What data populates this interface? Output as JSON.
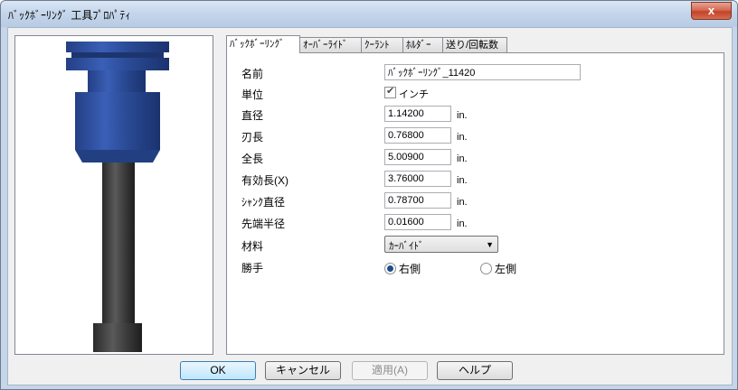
{
  "window": {
    "title": "ﾊﾞｯｸﾎﾞｰﾘﾝｸﾞ 工具ﾌﾟﾛﾊﾟﾃｨ",
    "close_label": "x"
  },
  "tabs": [
    {
      "label": "ﾊﾞｯｸﾎﾞｰﾘﾝｸﾞ",
      "active": true
    },
    {
      "label": "ｵｰﾊﾞｰﾗｲﾄﾞ",
      "active": false
    },
    {
      "label": "ｸｰﾗﾝﾄ",
      "active": false
    },
    {
      "label": "ﾎﾙﾀﾞｰ",
      "active": false
    },
    {
      "label": "送り/回転数",
      "active": false
    }
  ],
  "form": {
    "name_label": "名前",
    "name_value": "ﾊﾞｯｸﾎﾞｰﾘﾝｸﾞ_11420",
    "unit_label": "単位",
    "unit_checkbox_label": "インチ",
    "unit_checked": true,
    "unit_text": "in.",
    "rows": [
      {
        "label": "直径",
        "value": "1.14200"
      },
      {
        "label": "刃長",
        "value": "0.76800"
      },
      {
        "label": "全長",
        "value": "5.00900"
      },
      {
        "label": "有効長(X)",
        "value": "3.76000"
      },
      {
        "label": "ｼｬﾝｸ直径",
        "value": "0.78700"
      },
      {
        "label": "先端半径",
        "value": "0.01600"
      }
    ],
    "material_label": "材料",
    "material_value": "ｶｰﾊﾞｲﾄﾞ",
    "hand_label": "勝手",
    "hand_right": "右側",
    "hand_left": "左側",
    "hand_selected": "right"
  },
  "buttons": {
    "ok": "OK",
    "cancel": "キャンセル",
    "apply": "適用(A)",
    "help": "ヘルプ"
  },
  "colors": {
    "tool_head": "#2a4b96",
    "tool_shank": "#3a3a3a",
    "accent": "#3c7fb1"
  }
}
